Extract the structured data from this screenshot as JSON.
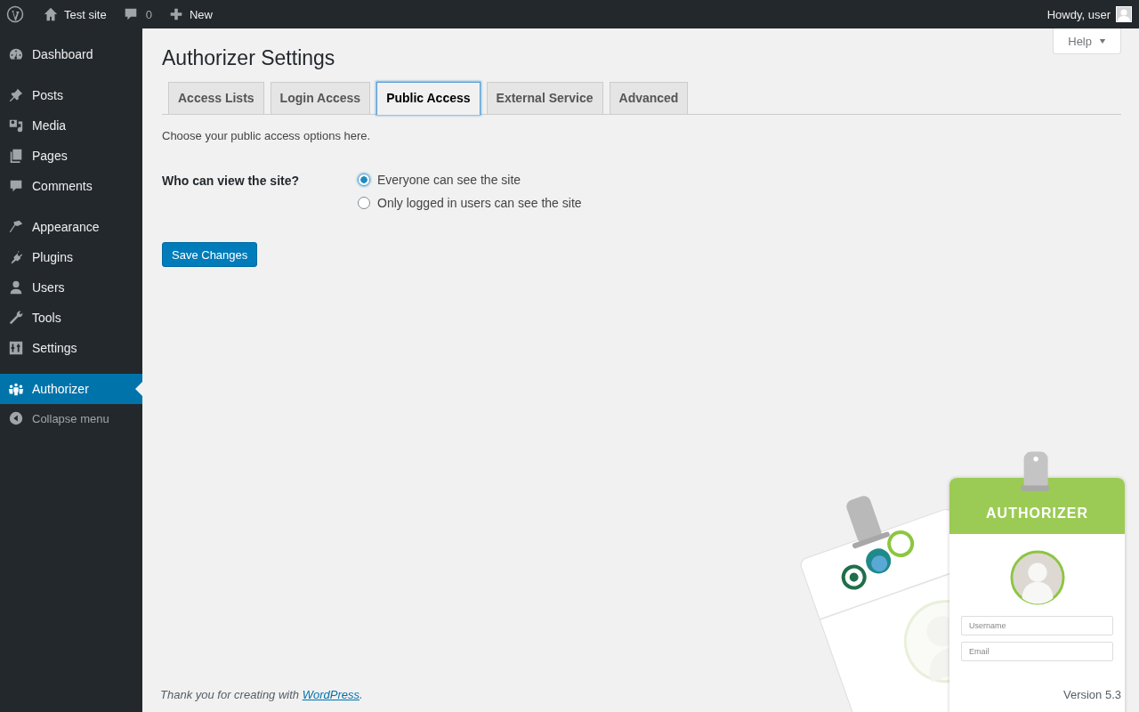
{
  "admin_bar": {
    "site": "Test site",
    "comments": "0",
    "new": "New",
    "greeting": "Howdy, user"
  },
  "sidebar": {
    "groups": [
      [
        {
          "label": "Dashboard",
          "selected": false
        }
      ],
      [
        {
          "label": "Posts",
          "selected": false
        },
        {
          "label": "Media",
          "selected": false
        },
        {
          "label": "Pages",
          "selected": false
        },
        {
          "label": "Comments",
          "selected": false
        }
      ],
      [
        {
          "label": "Appearance",
          "selected": false
        },
        {
          "label": "Plugins",
          "selected": false
        },
        {
          "label": "Users",
          "selected": false
        },
        {
          "label": "Tools",
          "selected": false
        },
        {
          "label": "Settings",
          "selected": false
        }
      ],
      [
        {
          "label": "Authorizer",
          "selected": true
        }
      ]
    ],
    "collapse": "Collapse menu"
  },
  "help": "Help",
  "title": "Authorizer Settings",
  "tabs": [
    {
      "label": "Access Lists",
      "selected": false
    },
    {
      "label": "Login Access",
      "selected": false
    },
    {
      "label": "Public Access",
      "selected": true
    },
    {
      "label": "External Service",
      "selected": false
    },
    {
      "label": "Advanced",
      "selected": false
    }
  ],
  "intro": "Choose your public access options here.",
  "field": {
    "label": "Who can view the site?",
    "options": [
      {
        "label": "Everyone can see the site",
        "selected": true
      },
      {
        "label": "Only logged in users can see the site",
        "selected": false
      }
    ]
  },
  "save": "Save Changes",
  "footer": {
    "before": "Thank you for creating with ",
    "link": "WordPress",
    "after": ".",
    "version": "Version 5.3"
  },
  "illustration": {
    "badge_title": "AUTHORIZER",
    "fields": [
      "Username",
      "Email"
    ]
  }
}
